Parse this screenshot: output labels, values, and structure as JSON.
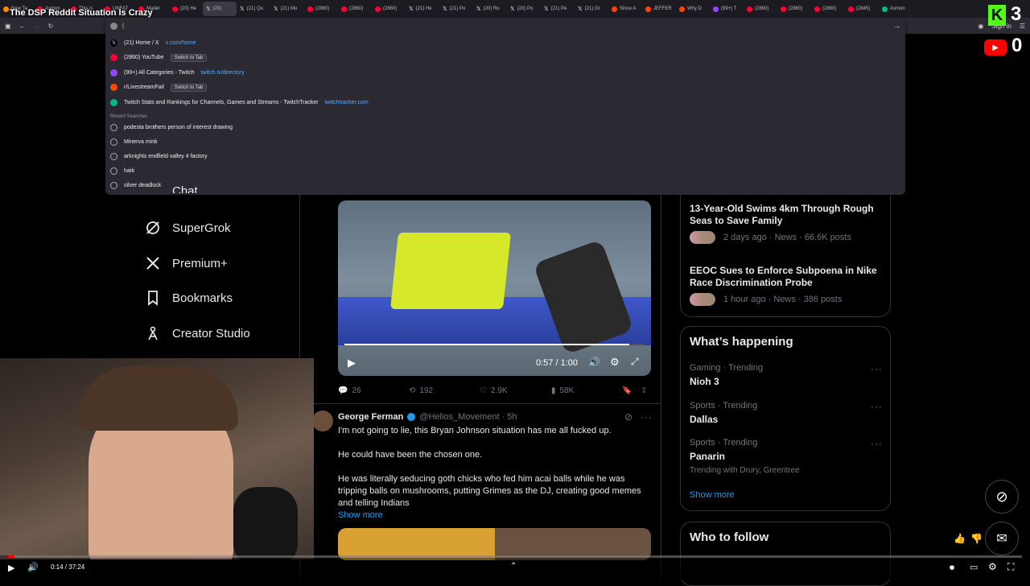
{
  "video_title": "The DSP Reddit Situation Is Crazy",
  "tabs": [
    {
      "label": "New Ta",
      "icon": "firefox"
    },
    {
      "label": "Asmon",
      "icon": "youtube"
    },
    {
      "label": "This is",
      "icon": "youtube"
    },
    {
      "label": "UNFAT",
      "icon": "youtube"
    },
    {
      "label": "Madel",
      "icon": "youtube"
    },
    {
      "label": "(20) He",
      "icon": "youtube"
    },
    {
      "label": "(20)",
      "icon": "x",
      "active": true
    },
    {
      "label": "(21) Qu",
      "icon": "x"
    },
    {
      "label": "(21) Mo",
      "icon": "x"
    },
    {
      "label": "(2860)",
      "icon": "youtube"
    },
    {
      "label": "(2860)",
      "icon": "youtube"
    },
    {
      "label": "(2860)",
      "icon": "youtube"
    },
    {
      "label": "(21) He",
      "icon": "x"
    },
    {
      "label": "(21) Po",
      "icon": "x"
    },
    {
      "label": "(20) Ro",
      "icon": "x"
    },
    {
      "label": "(20) Po",
      "icon": "x"
    },
    {
      "label": "(21) Pe",
      "icon": "x"
    },
    {
      "label": "(21) Gr",
      "icon": "x"
    },
    {
      "label": "Since A",
      "icon": "reddit"
    },
    {
      "label": "JEFFER",
      "icon": "reddit"
    },
    {
      "label": "Why D",
      "icon": "reddit"
    },
    {
      "label": "(99+) T",
      "icon": "twitch"
    },
    {
      "label": "(2860)",
      "icon": "youtube"
    },
    {
      "label": "(2860)",
      "icon": "youtube"
    },
    {
      "label": "(2860)",
      "icon": "youtube"
    },
    {
      "label": "(2845)",
      "icon": "youtube"
    },
    {
      "label": "Asmon",
      "icon": "tt"
    }
  ],
  "browser": {
    "sign_in": "Sign in",
    "url_value": "("
  },
  "suggestions": [
    {
      "icon": "x",
      "title": "(21) Home / X",
      "url": "x.com/home",
      "switch": ""
    },
    {
      "icon": "youtube",
      "title": "(2860) YouTube",
      "url": "",
      "switch": "Switch to Tab"
    },
    {
      "icon": "twitch",
      "title": "(99+) All Categories - Twitch",
      "url": "twitch.tv/directory",
      "switch": ""
    },
    {
      "icon": "reddit",
      "title": "r/LivestreamFail",
      "url": "",
      "switch": "Switch to Tab"
    },
    {
      "icon": "tt",
      "title": "Twitch Stats and Rankings for Channels, Games and Streams - TwitchTracker",
      "url": "twitchtracker.com",
      "switch": ""
    }
  ],
  "recent_label": "Recent Searches",
  "recent_searches": [
    "podesta brothers person of interest drawing",
    "Minerva mink",
    "arknights endfield valley 4 factory",
    "haiti",
    "silver deadlock"
  ],
  "x_nav": {
    "partial": "Chat",
    "supergrok": "SuperGrok",
    "premium": "Premium+",
    "bookmarks": "Bookmarks",
    "creator": "Creator Studio"
  },
  "video_player": {
    "time": "0:57 / 1:00",
    "progress": 0.95
  },
  "post_actions": {
    "replies": "26",
    "reposts": "192",
    "likes": "2.9K",
    "views": "58K"
  },
  "tweet": {
    "name": "George Ferman",
    "handle": "@Helios_Movement · 5h",
    "line1": "I'm not going to lie, this Bryan Johnson situation has me all fucked up.",
    "line2": "He could have been the chosen one.",
    "line3": "He was literally seducing goth chicks who fed him acai balls while he was tripping balls on mushrooms, putting Grimes as the DJ, creating good memes and telling Indians",
    "show_more": "Show more"
  },
  "news": [
    {
      "title": "13-Year-Old Swims 4km Through Rough Seas to Save Family",
      "meta": "2 days ago · News · 66.6K posts"
    },
    {
      "title": "EEOC Sues to Enforce Subpoena in Nike Race Discrimination Probe",
      "meta": "1 hour ago · News · 386 posts"
    }
  ],
  "whats_happening": {
    "title": "What’s happening",
    "trends": [
      {
        "meta": "Gaming · Trending",
        "name": "Nioh 3",
        "extra": ""
      },
      {
        "meta": "Sports · Trending",
        "name": "Dallas",
        "extra": ""
      },
      {
        "meta": "Sports · Trending",
        "name": "Panarin",
        "extra": "Trending with Drury, Greentree"
      }
    ],
    "show_more": "Show more"
  },
  "who_to_follow": "Who to follow",
  "overlay": {
    "kick_count": "3",
    "yt_count": "0"
  },
  "yt_player": {
    "time": "0:14 / 37:24",
    "progress": 0.006
  },
  "colors": {
    "accent": "#1d9bf0",
    "bg": "#000000",
    "kick": "#53fc18",
    "yt": "#ff0000"
  }
}
